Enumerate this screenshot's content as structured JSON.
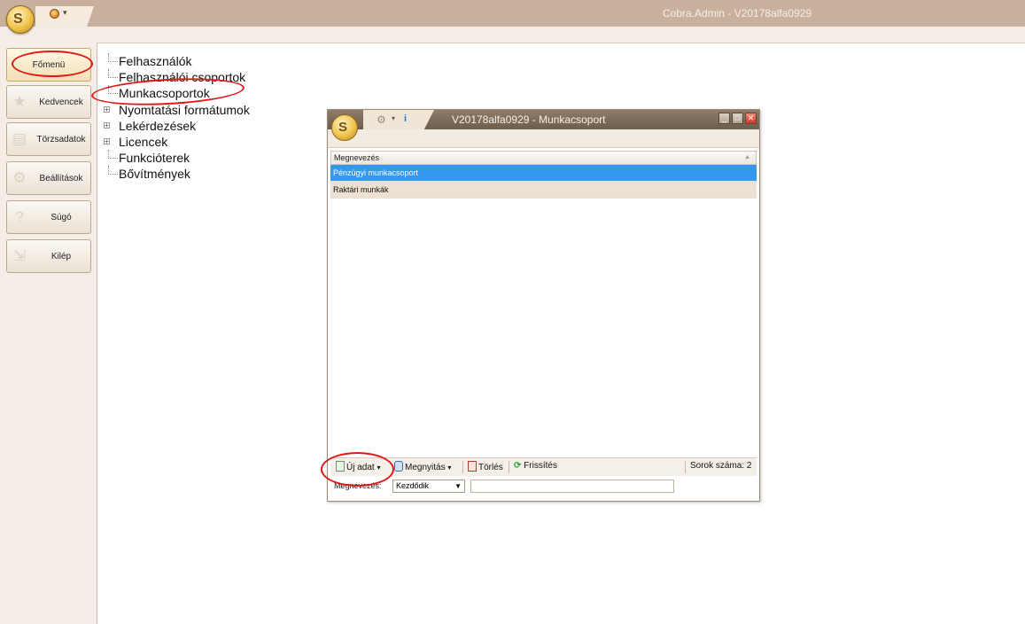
{
  "app": {
    "title": "Cobra.Admin - V20178alfa0929"
  },
  "nav": {
    "items": [
      {
        "label": "Főmenü",
        "icon": "home-icon"
      },
      {
        "label": "Kedvencek",
        "icon": "star-icon"
      },
      {
        "label": "Törzsadatok",
        "icon": "table-icon"
      },
      {
        "label": "Beállítások",
        "icon": "gear-icon"
      },
      {
        "label": "Súgó",
        "icon": "question-icon"
      },
      {
        "label": "Kilép",
        "icon": "exit-icon"
      }
    ]
  },
  "tree": {
    "nodes": [
      {
        "label": "Felhasználók",
        "expandable": false
      },
      {
        "label": "Felhasználói csoportok",
        "expandable": false
      },
      {
        "label": "Munkacsoportok",
        "expandable": false
      },
      {
        "label": "Nyomtatási formátumok",
        "expandable": true
      },
      {
        "label": "Lekérdezések",
        "expandable": true
      },
      {
        "label": "Licencek",
        "expandable": true
      },
      {
        "label": "Funkcióterek",
        "expandable": false
      },
      {
        "label": "Bővítmények",
        "expandable": false
      }
    ]
  },
  "window": {
    "title": "V20178alfa0929 - Munkacsoport",
    "grid": {
      "column": "Megnevezés",
      "rows": [
        "Pénzügyi munkacsoport",
        "Raktári munkák"
      ],
      "selected_index": 0
    },
    "toolbar": {
      "new": "Új adat",
      "open": "Megnyitás",
      "delete": "Törlés",
      "refresh": "Frissítés",
      "row_count_label": "Sorok száma:",
      "row_count": "2"
    },
    "filter": {
      "label": "Megnevezés:",
      "mode": "Kezdődik",
      "value": ""
    }
  },
  "colors": {
    "titlebar": "#c9b09d",
    "selection": "#3399ee",
    "annotation": "#e01818"
  }
}
